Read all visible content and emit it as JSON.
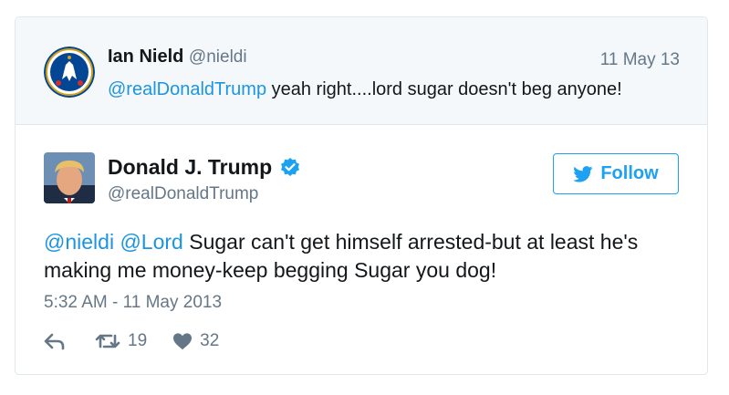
{
  "parent_tweet": {
    "name": "Ian Nield",
    "handle": "@nieldi",
    "date": "11 May 13",
    "mention": "@realDonaldTrump",
    "text": " yeah right....lord sugar doesn't beg anyone!"
  },
  "main_tweet": {
    "name": "Donald J. Trump",
    "handle": "@realDonaldTrump",
    "follow_label": "Follow",
    "mention1": "@nieldi",
    "mention2": "@Lord",
    "text": " Sugar can't get himself arrested-but at least he's making me money-keep begging Sugar you dog!",
    "timestamp": "5:32 AM - 11 May 2013",
    "retweets": "19",
    "likes": "32"
  },
  "icons": {
    "parent_avatar": "chelsea-crest-icon",
    "main_avatar": "profile-photo",
    "verified": "verified-badge-icon",
    "follow": "twitter-bird-icon",
    "reply": "reply-icon",
    "retweet": "retweet-icon",
    "like": "heart-icon"
  },
  "colors": {
    "accent": "#1da1f2",
    "link": "#1b95e0",
    "muted": "#657786",
    "parent_bg": "#f5f8fa"
  }
}
